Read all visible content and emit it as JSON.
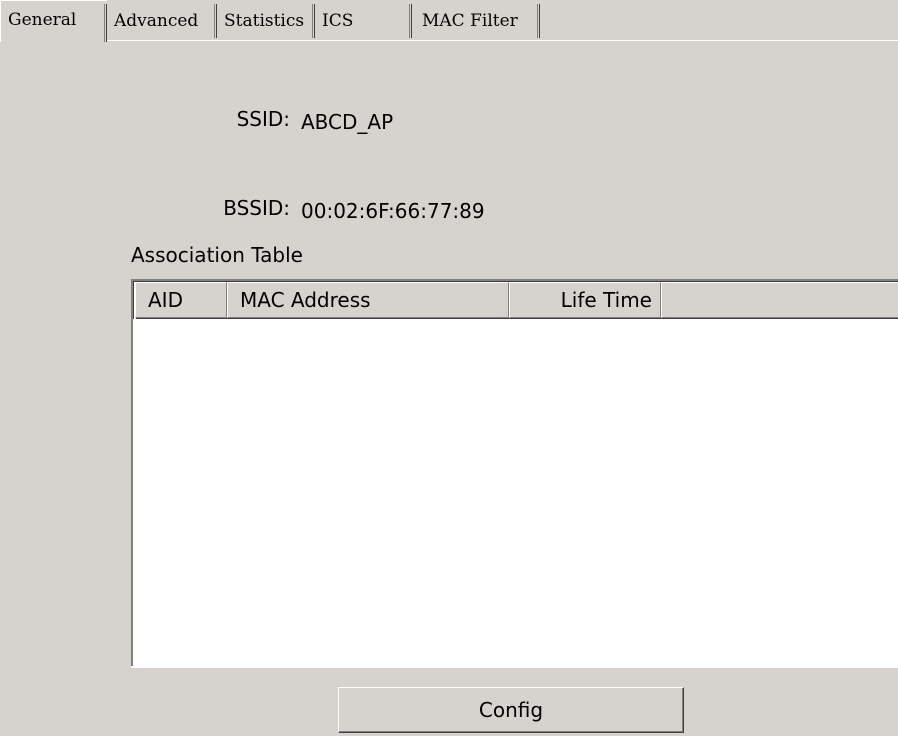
{
  "tabs": [
    {
      "label": "General",
      "active": true
    },
    {
      "label": "Advanced",
      "active": false
    },
    {
      "label": "Statistics",
      "active": false
    },
    {
      "label": "ICS",
      "active": false
    },
    {
      "label": "MAC Filter",
      "active": false
    }
  ],
  "general": {
    "ssid_label": "SSID:",
    "ssid_value": "ABCD_AP",
    "bssid_label": "BSSID:",
    "bssid_value": "00:02:6F:66:77:89",
    "association_table_label": "Association Table",
    "table": {
      "columns": [
        "AID",
        "MAC Address",
        "Life Time"
      ],
      "rows": []
    },
    "config_button": "Config"
  }
}
